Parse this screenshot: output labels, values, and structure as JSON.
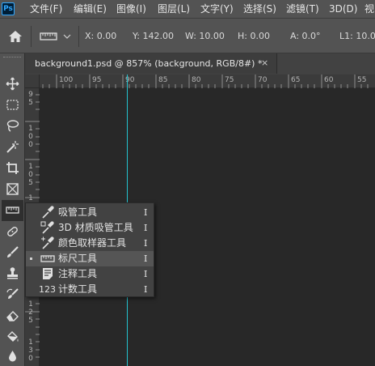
{
  "app": {
    "logo_text": "Ps"
  },
  "menu": [
    "文件(F)",
    "编辑(E)",
    "图像(I)",
    "图层(L)",
    "文字(Y)",
    "选择(S)",
    "滤镜(T)",
    "3D(D)",
    "视"
  ],
  "options_bar": {
    "x": "X: 0.00",
    "y": "Y: 142.00",
    "w": "W: 10.00",
    "h": "H: 0.00",
    "a": "A: 0.0°",
    "l1": "L1: 10.00"
  },
  "document_tab": {
    "title": "background1.psd @ 857% (background, RGB/8#) *",
    "close": "×"
  },
  "ruler": {
    "h_labels": [
      "100",
      "95",
      "90",
      "85",
      "80",
      "75",
      "70",
      "65",
      "60",
      "55"
    ],
    "v_labels": [
      [
        "9",
        "5"
      ],
      [
        "1",
        "0",
        "0"
      ],
      [
        "1",
        "0",
        "5"
      ],
      [
        "1"
      ],
      [
        "1",
        "2",
        "5"
      ],
      [
        "1",
        "3",
        "0"
      ]
    ]
  },
  "flyout": {
    "items": [
      {
        "label": "吸管工具",
        "key": "I",
        "icon": "eyedropper-icon",
        "selected": false
      },
      {
        "label": "3D 材质吸管工具",
        "key": "I",
        "icon": "3d-material-eyedropper-icon",
        "selected": false
      },
      {
        "label": "颜色取样器工具",
        "key": "I",
        "icon": "color-sampler-icon",
        "selected": false
      },
      {
        "label": "标尺工具",
        "key": "I",
        "icon": "ruler-icon",
        "selected": true
      },
      {
        "label": "注释工具",
        "key": "I",
        "icon": "note-icon",
        "selected": false
      },
      {
        "label": "计数工具",
        "key": "I",
        "icon": "count-icon",
        "selected": false
      }
    ],
    "count_icon_text": "123"
  },
  "colors": {
    "guide": "#24c4d0",
    "menubar": "#535353",
    "canvas": "#282828"
  }
}
